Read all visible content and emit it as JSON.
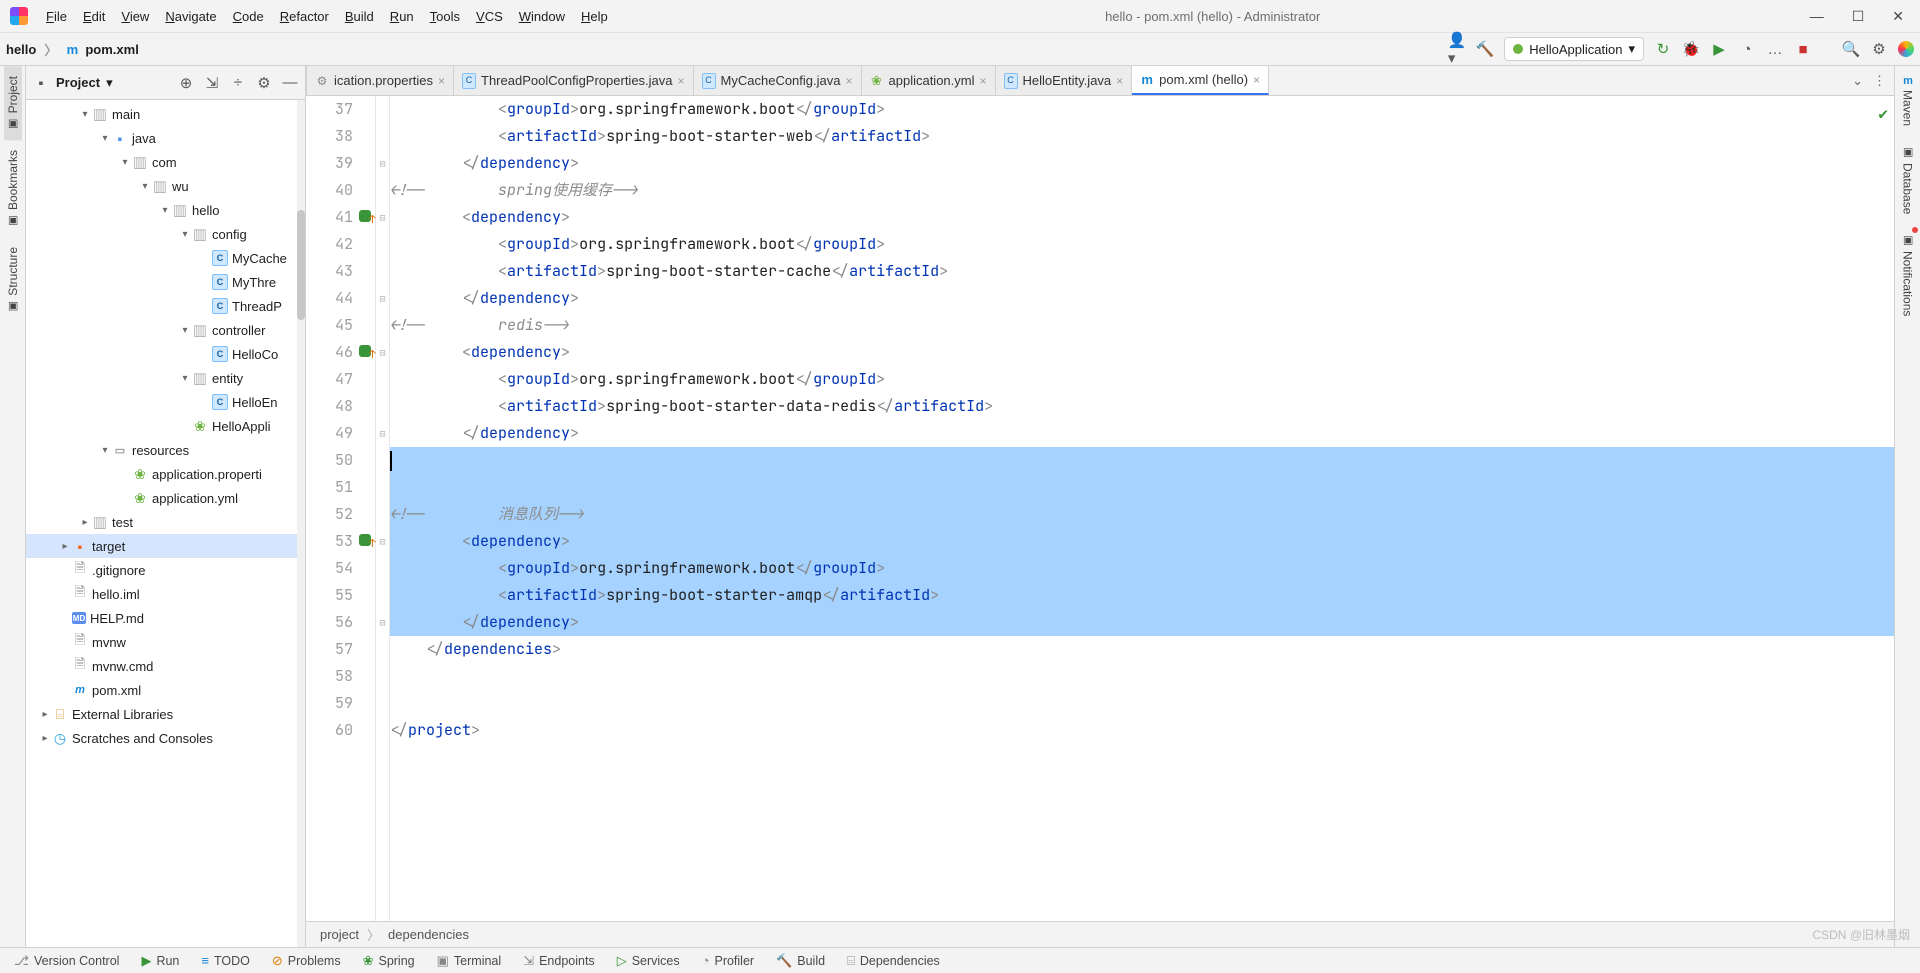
{
  "window": {
    "title": "hello - pom.xml (hello) - Administrator"
  },
  "menubar": [
    "File",
    "Edit",
    "View",
    "Navigate",
    "Code",
    "Refactor",
    "Build",
    "Run",
    "Tools",
    "VCS",
    "Window",
    "Help"
  ],
  "breadcrumb": {
    "project": "hello",
    "file": "pom.xml"
  },
  "runConfig": {
    "name": "HelloApplication"
  },
  "leftStrip": [
    {
      "id": "project",
      "label": "Project",
      "active": true
    },
    {
      "id": "bookmarks",
      "label": "Bookmarks"
    },
    {
      "id": "structure",
      "label": "Structure"
    }
  ],
  "rightStrip": [
    {
      "id": "maven",
      "label": "Maven",
      "icon": "m"
    },
    {
      "id": "database",
      "label": "Database"
    },
    {
      "id": "notifications",
      "label": "Notifications",
      "badge": true
    }
  ],
  "sidebar": {
    "title": "Project",
    "tree": [
      {
        "depth": 2,
        "tw": "▾",
        "ic": "fold",
        "label": "main"
      },
      {
        "depth": 3,
        "tw": "▾",
        "ic": "foldBlue",
        "label": "java"
      },
      {
        "depth": 4,
        "tw": "▾",
        "ic": "fold",
        "label": "com"
      },
      {
        "depth": 5,
        "tw": "▾",
        "ic": "fold",
        "label": "wu"
      },
      {
        "depth": 6,
        "tw": "▾",
        "ic": "fold",
        "label": "hello"
      },
      {
        "depth": 7,
        "tw": "▾",
        "ic": "fold",
        "label": "config"
      },
      {
        "depth": 8,
        "tw": "",
        "ic": "jclass",
        "label": "MyCache"
      },
      {
        "depth": 8,
        "tw": "",
        "ic": "jclass",
        "label": "MyThre"
      },
      {
        "depth": 8,
        "tw": "",
        "ic": "jclass",
        "label": "ThreadP"
      },
      {
        "depth": 7,
        "tw": "▾",
        "ic": "fold",
        "label": "controller"
      },
      {
        "depth": 8,
        "tw": "",
        "ic": "jclass",
        "label": "HelloCo"
      },
      {
        "depth": 7,
        "tw": "▾",
        "ic": "fold",
        "label": "entity"
      },
      {
        "depth": 8,
        "tw": "",
        "ic": "jclass",
        "label": "HelloEn"
      },
      {
        "depth": 7,
        "tw": "",
        "ic": "spring",
        "label": "HelloAppli"
      },
      {
        "depth": 3,
        "tw": "▾",
        "ic": "res",
        "label": "resources"
      },
      {
        "depth": 4,
        "tw": "",
        "ic": "spring",
        "label": "application.properti"
      },
      {
        "depth": 4,
        "tw": "",
        "ic": "spring",
        "label": "application.yml"
      },
      {
        "depth": 2,
        "tw": "▸",
        "ic": "fold",
        "label": "test"
      },
      {
        "depth": 1,
        "tw": "▸",
        "ic": "foldOrange",
        "label": "target",
        "sel": true
      },
      {
        "depth": 1,
        "tw": "",
        "ic": "file",
        "label": ".gitignore"
      },
      {
        "depth": 1,
        "tw": "",
        "ic": "file",
        "label": "hello.iml"
      },
      {
        "depth": 1,
        "tw": "",
        "ic": "md",
        "label": "HELP.md"
      },
      {
        "depth": 1,
        "tw": "",
        "ic": "file",
        "label": "mvnw"
      },
      {
        "depth": 1,
        "tw": "",
        "ic": "file",
        "label": "mvnw.cmd"
      },
      {
        "depth": 1,
        "tw": "",
        "ic": "m",
        "label": "pom.xml"
      },
      {
        "depth": 0,
        "tw": "▸",
        "ic": "lib",
        "label": "External Libraries"
      },
      {
        "depth": 0,
        "tw": "▸",
        "ic": "scratch",
        "label": "Scratches and Consoles"
      }
    ]
  },
  "tabs": [
    {
      "label": "ication.properties",
      "ic": "cfg"
    },
    {
      "label": "ThreadPoolConfigProperties.java",
      "ic": "j"
    },
    {
      "label": "MyCacheConfig.java",
      "ic": "j"
    },
    {
      "label": "application.yml",
      "ic": "sp"
    },
    {
      "label": "HelloEntity.java",
      "ic": "j"
    },
    {
      "label": "pom.xml (hello)",
      "ic": "m",
      "active": true
    }
  ],
  "code": {
    "firstLine": 37,
    "markers": {
      "41": "vcs",
      "46": "vcs",
      "53": "vcs"
    },
    "fold": {
      "37": "",
      "38": "",
      "39": "⊟",
      "40": "",
      "41": "⊟",
      "42": "",
      "43": "",
      "44": "⊟",
      "45": "",
      "46": "⊟",
      "47": "",
      "48": "",
      "49": "⊟",
      "50": "",
      "51": "",
      "52": "",
      "53": "⊟",
      "54": "",
      "55": "",
      "56": "⊟",
      "57": "",
      "58": "",
      "59": "",
      "60": ""
    },
    "lines": [
      {
        "n": 37,
        "ind": 12,
        "seg": [
          [
            "<",
            "cb"
          ],
          [
            "groupId",
            "t"
          ],
          [
            ">",
            "cb"
          ],
          [
            "org.springframework.boot",
            ""
          ],
          [
            "</",
            "cb"
          ],
          [
            "groupId",
            "t"
          ],
          [
            ">",
            "cb"
          ]
        ]
      },
      {
        "n": 38,
        "ind": 12,
        "seg": [
          [
            "<",
            "cb"
          ],
          [
            "artifactId",
            "t"
          ],
          [
            ">",
            "cb"
          ],
          [
            "spring-boot-starter-web",
            ""
          ],
          [
            "</",
            "cb"
          ],
          [
            "artifactId",
            "t"
          ],
          [
            ">",
            "cb"
          ]
        ]
      },
      {
        "n": 39,
        "ind": 8,
        "seg": [
          [
            "</",
            "cb"
          ],
          [
            "dependency",
            "t"
          ],
          [
            ">",
            "cb"
          ]
        ]
      },
      {
        "n": 40,
        "ind": 0,
        "seg": [
          [
            "<!--        spring使用缓存-->",
            "c"
          ]
        ]
      },
      {
        "n": 41,
        "ind": 8,
        "seg": [
          [
            "<",
            "cb"
          ],
          [
            "dependency",
            "t"
          ],
          [
            ">",
            "cb"
          ]
        ]
      },
      {
        "n": 42,
        "ind": 12,
        "seg": [
          [
            "<",
            "cb"
          ],
          [
            "groupId",
            "t"
          ],
          [
            ">",
            "cb"
          ],
          [
            "org.springframework.boot",
            ""
          ],
          [
            "</",
            "cb"
          ],
          [
            "groupId",
            "t"
          ],
          [
            ">",
            "cb"
          ]
        ]
      },
      {
        "n": 43,
        "ind": 12,
        "seg": [
          [
            "<",
            "cb"
          ],
          [
            "artifactId",
            "t"
          ],
          [
            ">",
            "cb"
          ],
          [
            "spring-boot-starter-cache",
            ""
          ],
          [
            "</",
            "cb"
          ],
          [
            "artifactId",
            "t"
          ],
          [
            ">",
            "cb"
          ]
        ]
      },
      {
        "n": 44,
        "ind": 8,
        "seg": [
          [
            "</",
            "cb"
          ],
          [
            "dependency",
            "t"
          ],
          [
            ">",
            "cb"
          ]
        ]
      },
      {
        "n": 45,
        "ind": 0,
        "seg": [
          [
            "<!--        redis-->",
            "c"
          ]
        ]
      },
      {
        "n": 46,
        "ind": 8,
        "seg": [
          [
            "<",
            "cb"
          ],
          [
            "dependency",
            "t"
          ],
          [
            ">",
            "cb"
          ]
        ]
      },
      {
        "n": 47,
        "ind": 12,
        "seg": [
          [
            "<",
            "cb"
          ],
          [
            "groupId",
            "t"
          ],
          [
            ">",
            "cb"
          ],
          [
            "org.springframework.boot",
            ""
          ],
          [
            "</",
            "cb"
          ],
          [
            "groupId",
            "t"
          ],
          [
            ">",
            "cb"
          ]
        ]
      },
      {
        "n": 48,
        "ind": 12,
        "seg": [
          [
            "<",
            "cb"
          ],
          [
            "artifactId",
            "t"
          ],
          [
            ">",
            "cb"
          ],
          [
            "spring-boot-starter-data-redis",
            ""
          ],
          [
            "</",
            "cb"
          ],
          [
            "artifactId",
            "t"
          ],
          [
            ">",
            "cb"
          ]
        ]
      },
      {
        "n": 49,
        "ind": 8,
        "seg": [
          [
            "</",
            "cb"
          ],
          [
            "dependency",
            "t"
          ],
          [
            ">",
            "cb"
          ]
        ]
      },
      {
        "n": 50,
        "ind": 0,
        "hl": true,
        "seg": [
          [
            "",
            ""
          ]
        ],
        "caret": true
      },
      {
        "n": 51,
        "ind": 0,
        "hl": true,
        "seg": [
          [
            "",
            ""
          ]
        ]
      },
      {
        "n": 52,
        "ind": 0,
        "hl": true,
        "seg": [
          [
            "<!--        消息队列-->",
            "c"
          ]
        ]
      },
      {
        "n": 53,
        "ind": 8,
        "hl": true,
        "seg": [
          [
            "<",
            "cb"
          ],
          [
            "dependency",
            "t"
          ],
          [
            ">",
            "cb"
          ]
        ]
      },
      {
        "n": 54,
        "ind": 12,
        "hl": true,
        "seg": [
          [
            "<",
            "cb"
          ],
          [
            "groupId",
            "t"
          ],
          [
            ">",
            "cb"
          ],
          [
            "org.springframework.boot",
            ""
          ],
          [
            "</",
            "cb"
          ],
          [
            "groupId",
            "t"
          ],
          [
            ">",
            "cb"
          ]
        ]
      },
      {
        "n": 55,
        "ind": 12,
        "hl": true,
        "seg": [
          [
            "<",
            "cb"
          ],
          [
            "artifactId",
            "t"
          ],
          [
            ">",
            "cb"
          ],
          [
            "spring-boot-starter-amqp",
            ""
          ],
          [
            "</",
            "cb"
          ],
          [
            "artifactId",
            "t"
          ],
          [
            ">",
            "cb"
          ]
        ]
      },
      {
        "n": 56,
        "ind": 8,
        "hl": true,
        "seg": [
          [
            "</",
            "cb"
          ],
          [
            "dependency",
            "t"
          ],
          [
            ">",
            "cb"
          ]
        ]
      },
      {
        "n": 57,
        "ind": 4,
        "seg": [
          [
            "</",
            "cb"
          ],
          [
            "dependencies",
            "t"
          ],
          [
            ">",
            "cb"
          ]
        ]
      },
      {
        "n": 58,
        "ind": 0,
        "seg": [
          [
            "",
            ""
          ]
        ]
      },
      {
        "n": 59,
        "ind": 0,
        "seg": [
          [
            "",
            ""
          ]
        ]
      },
      {
        "n": 60,
        "ind": 0,
        "seg": [
          [
            "</",
            "cb"
          ],
          [
            "project",
            "t"
          ],
          [
            ">",
            "cb"
          ]
        ]
      }
    ],
    "crumbs": [
      "project",
      "dependencies"
    ]
  },
  "bottom": [
    {
      "ic": "gray",
      "glyph": "⎇",
      "label": "Version Control"
    },
    {
      "ic": "green",
      "glyph": "▶",
      "label": "Run"
    },
    {
      "ic": "blue",
      "glyph": "≡",
      "label": "TODO"
    },
    {
      "ic": "orange",
      "glyph": "⊘",
      "label": "Problems"
    },
    {
      "ic": "green",
      "glyph": "❀",
      "label": "Spring"
    },
    {
      "ic": "gray",
      "glyph": "▣",
      "label": "Terminal"
    },
    {
      "ic": "gray",
      "glyph": "⇲",
      "label": "Endpoints"
    },
    {
      "ic": "green",
      "glyph": "▷",
      "label": "Services"
    },
    {
      "ic": "gray",
      "glyph": "◔",
      "label": "Profiler"
    },
    {
      "ic": "gray",
      "glyph": "🔨",
      "label": "Build"
    },
    {
      "ic": "gray",
      "glyph": "⌸",
      "label": "Dependencies"
    }
  ],
  "watermark": "CSDN @旧林墨烟"
}
